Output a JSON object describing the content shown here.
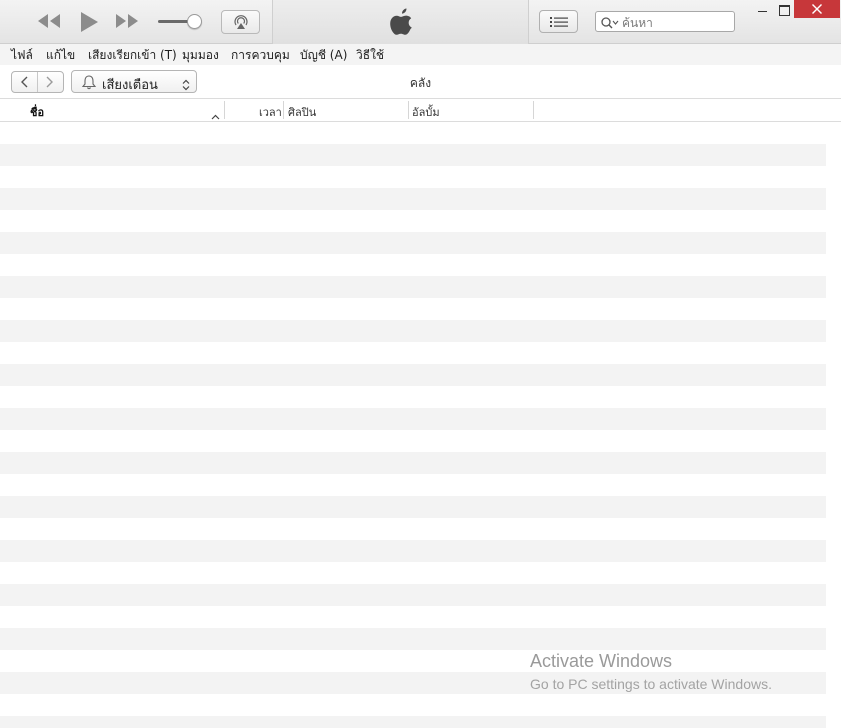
{
  "toolbar": {
    "search_placeholder": "ค้นหา"
  },
  "menu": {
    "items": [
      "ไฟล์",
      "แก้ไข",
      "เสียงเรียกเข้า (T)",
      "มุมมอง",
      "การควบคุม",
      "บัญชี (A)",
      "วิธีใช้"
    ]
  },
  "nav": {
    "library_select": "เสียงเตือน",
    "page_title": "คลัง"
  },
  "table": {
    "columns": [
      "ชื่อ",
      "เวลา",
      "ศิลปิน",
      "อัลบั้ม"
    ],
    "rows": []
  },
  "watermark": {
    "title": "Activate Windows",
    "subtitle": "Go to PC settings to activate Windows."
  },
  "colors": {
    "close_button": "#c7373a",
    "row_alt": "#f3f3f3",
    "titlebar": "#e4e4e4"
  },
  "icons": [
    "rewind-icon",
    "play-icon",
    "fast-forward-icon",
    "volume-slider",
    "airplay-icon",
    "apple-logo-icon",
    "list-view-icon",
    "search-icon",
    "minimize-icon",
    "maximize-icon",
    "close-icon",
    "back-chevron-icon",
    "forward-chevron-icon",
    "bell-icon",
    "updown-chevron-icon",
    "sort-ascending-icon"
  ]
}
